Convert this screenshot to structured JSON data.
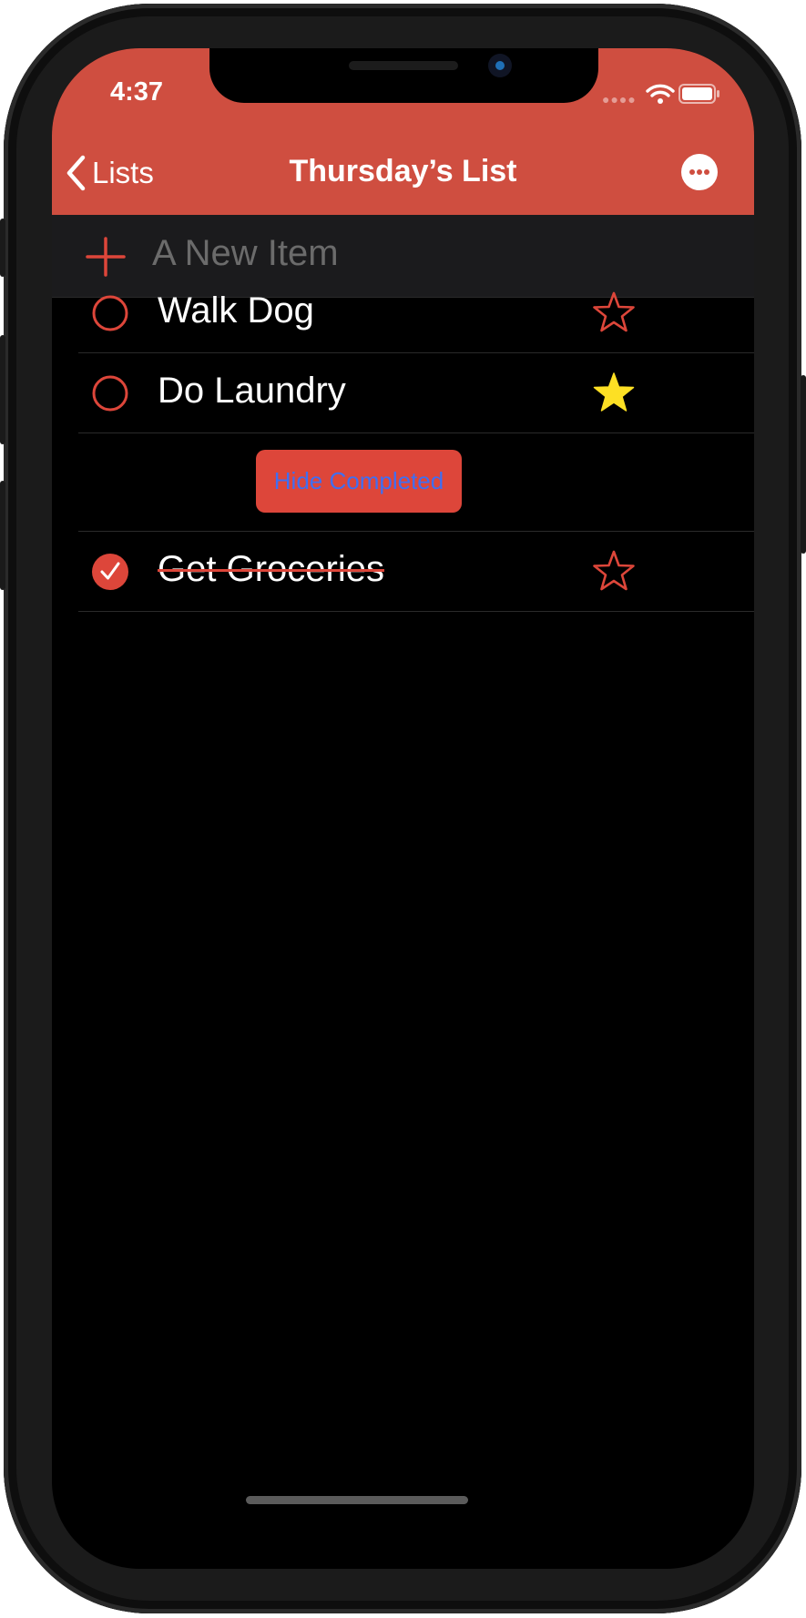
{
  "status_bar": {
    "time": "4:37"
  },
  "nav": {
    "back_label": "Lists",
    "title": "Thursday’s List"
  },
  "new_item": {
    "placeholder": "A New Item"
  },
  "items": [
    {
      "label": "Walk Dog",
      "completed": false,
      "starred": false
    },
    {
      "label": "Do Laundry",
      "completed": false,
      "starred": true
    }
  ],
  "hide_completed_label": "Hide Completed",
  "completed_items": [
    {
      "label": "Get Groceries",
      "completed": true,
      "starred": false
    }
  ],
  "colors": {
    "accent": "#cf4e40",
    "button": "#dd463a",
    "button_text": "#3f6ef2",
    "star_filled": "#fde024",
    "background": "#000000"
  },
  "icons": [
    "back-chevron-icon",
    "more-icon",
    "plus-icon",
    "circle-icon",
    "star-icon",
    "checkmark-circle-icon",
    "wifi-icon",
    "battery-icon"
  ]
}
